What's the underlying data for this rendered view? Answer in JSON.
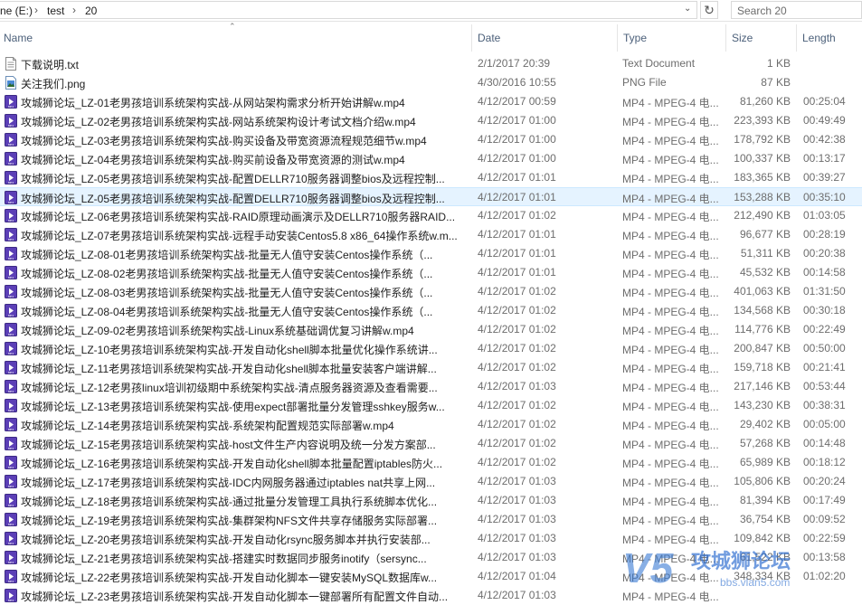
{
  "address": {
    "drive": "ne (E:)",
    "crumbs": [
      "test",
      "20"
    ],
    "search_placeholder": "Search 20"
  },
  "columns": {
    "name": "Name",
    "date": "Date",
    "type": "Type",
    "size": "Size",
    "length": "Length"
  },
  "files": [
    {
      "name": "下载说明.txt",
      "date": "2/1/2017 20:39",
      "type": "Text Document",
      "size": "1 KB",
      "length": "",
      "icon": "txt"
    },
    {
      "name": "关注我们.png",
      "date": "4/30/2016 10:55",
      "type": "PNG File",
      "size": "87 KB",
      "length": "",
      "icon": "png"
    },
    {
      "name": "攻城狮论坛_LZ-01老男孩培训系统架构实战-从网站架构需求分析开始讲解w.mp4",
      "date": "4/12/2017 00:59",
      "type": "MP4 - MPEG-4 电...",
      "size": "81,260 KB",
      "length": "00:25:04",
      "icon": "mp4"
    },
    {
      "name": "攻城狮论坛_LZ-02老男孩培训系统架构实战-网站系统架构设计考试文档介绍w.mp4",
      "date": "4/12/2017 01:00",
      "type": "MP4 - MPEG-4 电...",
      "size": "223,393 KB",
      "length": "00:49:49",
      "icon": "mp4"
    },
    {
      "name": "攻城狮论坛_LZ-03老男孩培训系统架构实战-购买设备及带宽资源流程规范细节w.mp4",
      "date": "4/12/2017 01:00",
      "type": "MP4 - MPEG-4 电...",
      "size": "178,792 KB",
      "length": "00:42:38",
      "icon": "mp4"
    },
    {
      "name": "攻城狮论坛_LZ-04老男孩培训系统架构实战-购买前设备及带宽资源的测试w.mp4",
      "date": "4/12/2017 01:00",
      "type": "MP4 - MPEG-4 电...",
      "size": "100,337 KB",
      "length": "00:13:17",
      "icon": "mp4"
    },
    {
      "name": "攻城狮论坛_LZ-05老男孩培训系统架构实战-配置DELLR710服务器调整bios及远程控制...",
      "date": "4/12/2017 01:01",
      "type": "MP4 - MPEG-4 电...",
      "size": "183,365 KB",
      "length": "00:39:27",
      "icon": "mp4"
    },
    {
      "name": "攻城狮论坛_LZ-05老男孩培训系统架构实战-配置DELLR710服务器调整bios及远程控制...",
      "date": "4/12/2017 01:01",
      "type": "MP4 - MPEG-4 电...",
      "size": "153,288 KB",
      "length": "00:35:10",
      "icon": "mp4",
      "selected": true
    },
    {
      "name": "攻城狮论坛_LZ-06老男孩培训系统架构实战-RAID原理动画演示及DELLR710服务器RAID...",
      "date": "4/12/2017 01:02",
      "type": "MP4 - MPEG-4 电...",
      "size": "212,490 KB",
      "length": "01:03:05",
      "icon": "mp4"
    },
    {
      "name": "攻城狮论坛_LZ-07老男孩培训系统架构实战-远程手动安装Centos5.8 x86_64操作系统w.m...",
      "date": "4/12/2017 01:01",
      "type": "MP4 - MPEG-4 电...",
      "size": "96,677 KB",
      "length": "00:28:19",
      "icon": "mp4"
    },
    {
      "name": "攻城狮论坛_LZ-08-01老男孩培训系统架构实战-批量无人值守安装Centos操作系统（...",
      "date": "4/12/2017 01:01",
      "type": "MP4 - MPEG-4 电...",
      "size": "51,311 KB",
      "length": "00:20:38",
      "icon": "mp4"
    },
    {
      "name": "攻城狮论坛_LZ-08-02老男孩培训系统架构实战-批量无人值守安装Centos操作系统（...",
      "date": "4/12/2017 01:01",
      "type": "MP4 - MPEG-4 电...",
      "size": "45,532 KB",
      "length": "00:14:58",
      "icon": "mp4"
    },
    {
      "name": "攻城狮论坛_LZ-08-03老男孩培训系统架构实战-批量无人值守安装Centos操作系统（...",
      "date": "4/12/2017 01:02",
      "type": "MP4 - MPEG-4 电...",
      "size": "401,063 KB",
      "length": "01:31:50",
      "icon": "mp4"
    },
    {
      "name": "攻城狮论坛_LZ-08-04老男孩培训系统架构实战-批量无人值守安装Centos操作系统（...",
      "date": "4/12/2017 01:02",
      "type": "MP4 - MPEG-4 电...",
      "size": "134,568 KB",
      "length": "00:30:18",
      "icon": "mp4"
    },
    {
      "name": "攻城狮论坛_LZ-09-02老男孩培训系统架构实战-Linux系统基础调优复习讲解w.mp4",
      "date": "4/12/2017 01:02",
      "type": "MP4 - MPEG-4 电...",
      "size": "114,776 KB",
      "length": "00:22:49",
      "icon": "mp4"
    },
    {
      "name": "攻城狮论坛_LZ-10老男孩培训系统架构实战-开发自动化shell脚本批量优化操作系统讲...",
      "date": "4/12/2017 01:02",
      "type": "MP4 - MPEG-4 电...",
      "size": "200,847 KB",
      "length": "00:50:00",
      "icon": "mp4"
    },
    {
      "name": "攻城狮论坛_LZ-11老男孩培训系统架构实战-开发自动化shell脚本批量安装客户端讲解...",
      "date": "4/12/2017 01:02",
      "type": "MP4 - MPEG-4 电...",
      "size": "159,718 KB",
      "length": "00:21:41",
      "icon": "mp4"
    },
    {
      "name": "攻城狮论坛_LZ-12老男孩linux培训初级期中系统架构实战-清点服务器资源及查看需要...",
      "date": "4/12/2017 01:03",
      "type": "MP4 - MPEG-4 电...",
      "size": "217,146 KB",
      "length": "00:53:44",
      "icon": "mp4"
    },
    {
      "name": "攻城狮论坛_LZ-13老男孩培训系统架构实战-使用expect部署批量分发管理sshkey服务w...",
      "date": "4/12/2017 01:02",
      "type": "MP4 - MPEG-4 电...",
      "size": "143,230 KB",
      "length": "00:38:31",
      "icon": "mp4"
    },
    {
      "name": "攻城狮论坛_LZ-14老男孩培训系统架构实战-系统架构配置规范实际部署w.mp4",
      "date": "4/12/2017 01:02",
      "type": "MP4 - MPEG-4 电...",
      "size": "29,402 KB",
      "length": "00:05:00",
      "icon": "mp4"
    },
    {
      "name": "攻城狮论坛_LZ-15老男孩培训系统架构实战-host文件生产内容说明及统一分发方案部...",
      "date": "4/12/2017 01:02",
      "type": "MP4 - MPEG-4 电...",
      "size": "57,268 KB",
      "length": "00:14:48",
      "icon": "mp4"
    },
    {
      "name": "攻城狮论坛_LZ-16老男孩培训系统架构实战-开发自动化shell脚本批量配置iptables防火...",
      "date": "4/12/2017 01:02",
      "type": "MP4 - MPEG-4 电...",
      "size": "65,989 KB",
      "length": "00:18:12",
      "icon": "mp4"
    },
    {
      "name": "攻城狮论坛_LZ-17老男孩培训系统架构实战-IDC内网服务器通过iptables nat共享上网...",
      "date": "4/12/2017 01:03",
      "type": "MP4 - MPEG-4 电...",
      "size": "105,806 KB",
      "length": "00:20:24",
      "icon": "mp4"
    },
    {
      "name": "攻城狮论坛_LZ-18老男孩培训系统架构实战-通过批量分发管理工具执行系统脚本优化...",
      "date": "4/12/2017 01:03",
      "type": "MP4 - MPEG-4 电...",
      "size": "81,394 KB",
      "length": "00:17:49",
      "icon": "mp4"
    },
    {
      "name": "攻城狮论坛_LZ-19老男孩培训系统架构实战-集群架构NFS文件共享存储服务实际部署...",
      "date": "4/12/2017 01:03",
      "type": "MP4 - MPEG-4 电...",
      "size": "36,754 KB",
      "length": "00:09:52",
      "icon": "mp4"
    },
    {
      "name": "攻城狮论坛_LZ-20老男孩培训系统架构实战-开发自动化rsync服务脚本并执行安装部...",
      "date": "4/12/2017 01:03",
      "type": "MP4 - MPEG-4 电...",
      "size": "109,842 KB",
      "length": "00:22:59",
      "icon": "mp4"
    },
    {
      "name": "攻城狮论坛_LZ-21老男孩培训系统架构实战-搭建实时数据同步服务inotify（sersync...",
      "date": "4/12/2017 01:03",
      "type": "MP4 - MPEG-4 电...",
      "size": "61,522 KB",
      "length": "00:13:58",
      "icon": "mp4"
    },
    {
      "name": "攻城狮论坛_LZ-22老男孩培训系统架构实战-开发自动化脚本一键安装MySQL数据库w...",
      "date": "4/12/2017 01:04",
      "type": "MP4 - MPEG-4 电...",
      "size": "348,334 KB",
      "length": "01:02:20",
      "icon": "mp4"
    },
    {
      "name": "攻城狮论坛_LZ-23老男孩培训系统架构实战-开发自动化脚本一键部署所有配置文件自动...",
      "date": "4/12/2017 01:03",
      "type": "MP4 - MPEG-4 电...",
      "size": "",
      "length": "",
      "icon": "mp4"
    }
  ],
  "watermark": {
    "mark": "V5",
    "title": "攻城狮论坛",
    "url": "bbs.vlan5.com"
  }
}
